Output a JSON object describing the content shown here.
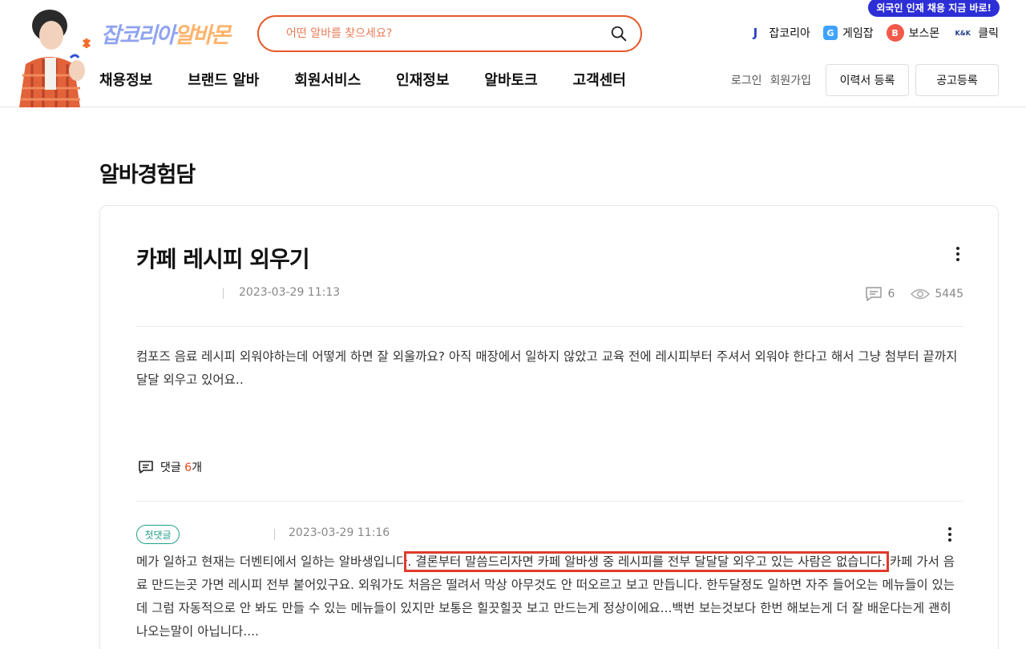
{
  "header": {
    "logo": {
      "main": "잡코리아",
      "accent": "알바몬"
    },
    "search": {
      "placeholder": "어떤 알바를 찾으세요?"
    },
    "promo_bubble": "외국인 인재 채용 지금 바로!",
    "family_sites": [
      {
        "label": "잡코리아",
        "icon": "jobkorea-icon",
        "glyph": "J"
      },
      {
        "label": "게임잡",
        "icon": "gamejob-icon",
        "glyph": "G"
      },
      {
        "label": "보스몬",
        "icon": "bossmon-icon",
        "glyph": "B"
      },
      {
        "label": "클릭",
        "icon": "klik-icon",
        "glyph": "K&K"
      }
    ],
    "nav": [
      "채용정보",
      "브랜드 알바",
      "회원서비스",
      "인재정보",
      "알바토크",
      "고객센터"
    ],
    "util": {
      "login": "로그인",
      "signup": "회원가입",
      "resume_button": "이력서 등록",
      "post_job_button": "공고등록"
    }
  },
  "page": {
    "title": "알바경험담"
  },
  "post": {
    "title": "카페 레시피 외우기",
    "date": "2023-03-29 11:13",
    "comment_count": "6",
    "view_count": "5445",
    "body": "컴포즈 음료 레시피 외워야하는데 어떻게 하면 잘 외울까요? 아직 매장에서 일하지 않았고 교육 전에 레시피부터 주셔서 외워야 한다고 해서 그냥 첨부터 끝까지 달달 외우고 있어요..",
    "comments_label_prefix": "댓글",
    "comments_label_num": "6",
    "comments_label_suffix": "개"
  },
  "comment": {
    "badge": "첫댓글",
    "date": "2023-03-29 11:16",
    "text_before": "메가 일하고 현재는 더벤티에서 일하는 알바생입니다",
    "text_highlight": ". 결론부터 말씀드리자면 카페 알바생 중 레시피를 전부 달달달 외우고 있는 사람은 없습니다.",
    "text_after": " 카페 가서 음료 만드는곳 가면 레시피 전부 붙어있구요. 외워가도 처음은 떨려서 막상 아무것도 안 떠오르고 보고 만듭니다. 한두달정도 일하면 자주 들어오는 메뉴들이 있는데 그럼 자동적으로 안 봐도 만들 수 있는 메뉴들이 있지만 보통은 힐끗힐끗 보고 만드는게 정상이에요...백번 보는것보다 한번 해보는게 더 잘 배운다는게 괜히 나오는말이 아닙니다...."
  },
  "colors": {
    "accent": "#e55a2b",
    "highlight_box": "#e03a2a",
    "badge": "#23a08c",
    "promo": "#2d2ed6"
  }
}
